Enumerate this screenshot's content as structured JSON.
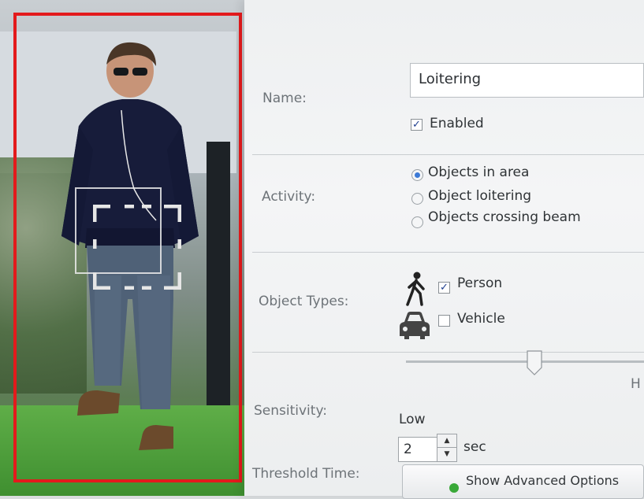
{
  "scene": {
    "frame_color": "#e31a1c"
  },
  "form": {
    "name_label": "Name:",
    "name_value": "Loitering",
    "enabled_label": "Enabled",
    "enabled_checked": true,
    "activity_label": "Activity:",
    "activity_options": [
      {
        "label": "Objects in area",
        "selected": true
      },
      {
        "label": "Object loitering",
        "selected": false
      },
      {
        "label": "Objects crossing beam",
        "selected": false
      }
    ],
    "object_types_label": "Object Types:",
    "object_types": [
      {
        "label": "Person",
        "checked": true,
        "icon": "person-walking-icon"
      },
      {
        "label": "Vehicle",
        "checked": false,
        "icon": "car-icon"
      }
    ],
    "sensitivity_label": "Sensitivity:",
    "sensitivity_low": "Low",
    "sensitivity_high_partial": "H",
    "threshold_label": "Threshold Time:",
    "threshold_value": "2",
    "threshold_unit": "sec",
    "advanced_button": "Show Advanced Options"
  },
  "colors": {
    "accent": "#3d7ad6",
    "advanced_icon": "#39a838"
  }
}
